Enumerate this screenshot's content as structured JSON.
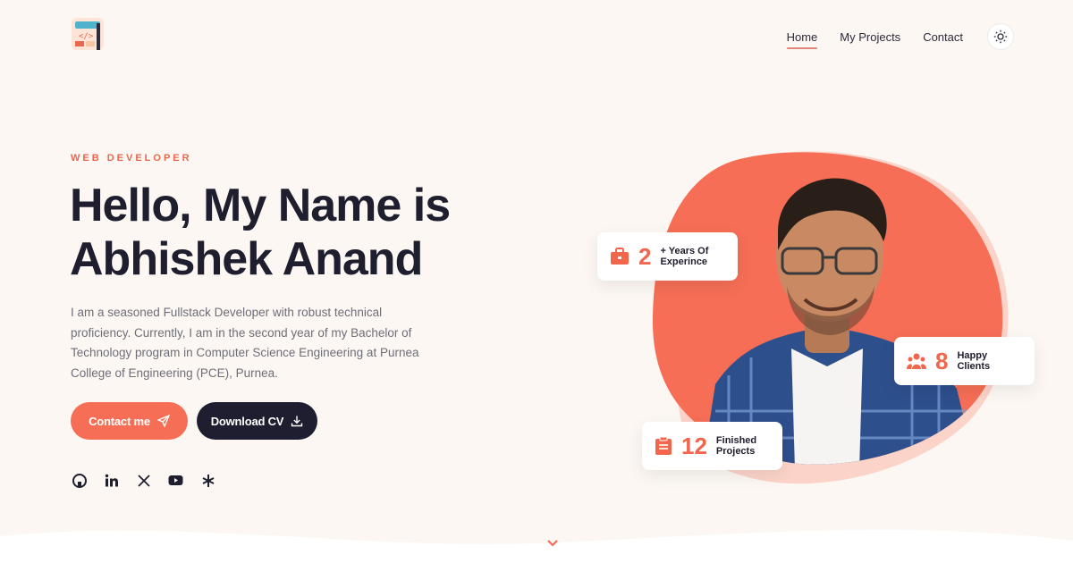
{
  "nav": {
    "items": [
      {
        "label": "Home",
        "active": true
      },
      {
        "label": "My Projects",
        "active": false
      },
      {
        "label": "Contact",
        "active": false
      }
    ],
    "theme_icon": "sun-icon"
  },
  "hero": {
    "eyebrow": "WEB DEVELOPER",
    "title_line1": "Hello, My Name is",
    "title_line2": "Abhishek Anand",
    "description": "I am a seasoned Fullstack Developer with robust technical proficiency. Currently, I am in the second year of my Bachelor of Technology program in Computer Science Engineering at Purnea College of Engineering (PCE), Purnea.",
    "contact_label": "Contact me",
    "cv_label": "Download CV"
  },
  "socials": [
    "github-icon",
    "linkedin-icon",
    "x-icon",
    "youtube-icon",
    "linktree-icon"
  ],
  "stats": {
    "experience": {
      "value": "2",
      "label_line1": "+ Years Of",
      "label_line2": "Experince"
    },
    "clients": {
      "value": "8",
      "label_line1": "Happy",
      "label_line2": "Clients"
    },
    "projects": {
      "value": "12",
      "label_line1": "Finished",
      "label_line2": "Projects"
    }
  },
  "colors": {
    "accent": "#f56e55",
    "dark": "#1e1e30",
    "background": "#fcf7f3"
  }
}
